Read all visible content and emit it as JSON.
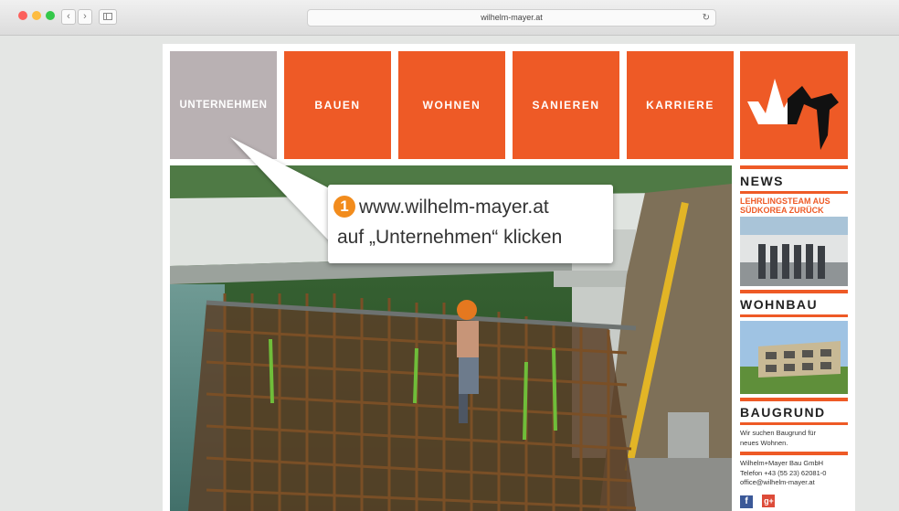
{
  "browser": {
    "url": "wilhelm-mayer.at"
  },
  "nav": [
    {
      "label": "UNTERNEHMEN"
    },
    {
      "label": "BAUEN"
    },
    {
      "label": "WOHNEN"
    },
    {
      "label": "SANIEREN"
    },
    {
      "label": "KARRIERE"
    }
  ],
  "sidebar": {
    "news_title": "NEWS",
    "news_link": "LEHRLINGSTEAM AUS SÜDKOREA ZURÜCK",
    "wohnbau_title": "WOHNBAU",
    "baugrund_title": "BAUGRUND",
    "baugrund_text": "Wir suchen Baugrund für neues Wohnen.",
    "company": "Wilhelm+Mayer Bau GmbH",
    "phone": "Telefon +43 (55 23) 62081-0",
    "email": "office@wilhelm-mayer.at",
    "social": [
      "f",
      "g+"
    ]
  },
  "callout": {
    "step": "1",
    "line1": "www.wilhelm-mayer.at",
    "line2": "auf „Unternehmen“ klicken"
  },
  "colors": {
    "accent": "#ee5a26",
    "active_nav": "#b9b1b3",
    "step_badge": "#f28c1d"
  }
}
